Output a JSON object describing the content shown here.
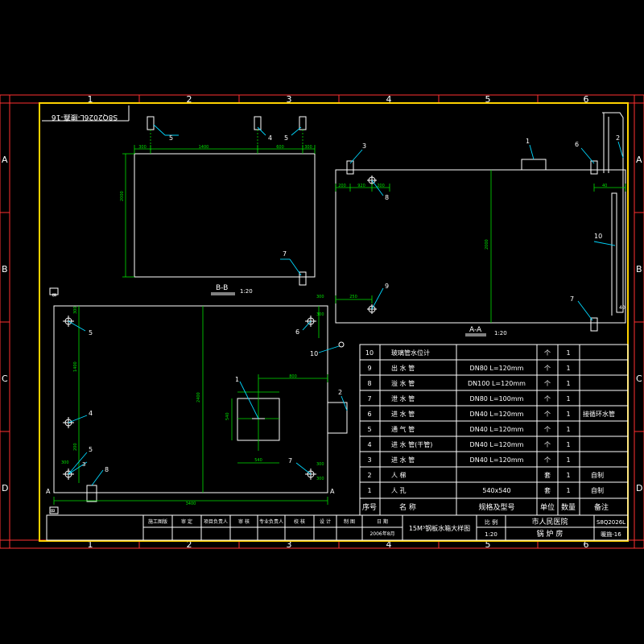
{
  "colors": {
    "background": "#000000",
    "frame": "#ffd200",
    "line": "#ffffff",
    "dimension": "#00e000",
    "leader": "#00d8ff",
    "grid": "#ff3030"
  },
  "border": {
    "cols_top": [
      "1",
      "2",
      "3",
      "4",
      "5",
      "6"
    ],
    "cols_bottom": [
      "1",
      "2",
      "3",
      "4",
      "5",
      "6"
    ],
    "rows_left": [
      "A",
      "B",
      "C",
      "D"
    ],
    "rows_right": [
      "A",
      "B",
      "C",
      "D"
    ]
  },
  "corner_label": "S8Q2026L-腰鑫-16",
  "views": {
    "bb": {
      "title": "B-B",
      "scale": "1:20",
      "dims_top": [
        "300",
        "1400",
        "600",
        "300"
      ],
      "dim_left": "2000",
      "callouts": [
        "5",
        "4",
        "5",
        "7"
      ]
    },
    "aa": {
      "title": "A-A",
      "scale": "1:20",
      "dims_top": [
        "200",
        "920",
        "200"
      ],
      "dim_center": "2000",
      "dim_bottom_left": "250",
      "dims_right": [
        "40",
        "40"
      ],
      "callouts": [
        "3",
        "1",
        "6",
        "2",
        "8",
        "10",
        "9",
        "7"
      ]
    },
    "plan": {
      "sec_top": "B",
      "sec_bottom": "B",
      "sec_a_left": "A",
      "sec_a_right": "A",
      "dim_overall_width": "3400",
      "dim_overall_height": "2400",
      "dim_top_right": "800",
      "dims_left": [
        "300",
        "1400",
        "200",
        "300"
      ],
      "dims_right": [
        "300",
        "300",
        "300",
        "300"
      ],
      "dim_box_w": "540",
      "dim_box_h": "540",
      "callouts": [
        "5",
        "6",
        "10",
        "1",
        "2",
        "4",
        "5",
        "3",
        "8",
        "7"
      ]
    }
  },
  "parts_table": {
    "rows": [
      {
        "no": "10",
        "name": "玻璃管水位计",
        "spec": "",
        "unit": "个",
        "qty": "1",
        "note": ""
      },
      {
        "no": "9",
        "name": "出 水 管",
        "spec": "DN80  L=120mm",
        "unit": "个",
        "qty": "1",
        "note": ""
      },
      {
        "no": "8",
        "name": "溢 水 管",
        "spec": "DN100  L=120mm",
        "unit": "个",
        "qty": "1",
        "note": ""
      },
      {
        "no": "7",
        "name": "泄 水 管",
        "spec": "DN80  L=100mm",
        "unit": "个",
        "qty": "1",
        "note": ""
      },
      {
        "no": "6",
        "name": "进 水 管",
        "spec": "DN40  L=120mm",
        "unit": "个",
        "qty": "1",
        "note": "接循环水管"
      },
      {
        "no": "5",
        "name": "通 气 管",
        "spec": "DN40  L=120mm",
        "unit": "个",
        "qty": "1",
        "note": ""
      },
      {
        "no": "4",
        "name": "进 水 管(干管)",
        "spec": "DN40  L=120mm",
        "unit": "个",
        "qty": "1",
        "note": ""
      },
      {
        "no": "3",
        "name": "进 水 管",
        "spec": "DN40  L=120mm",
        "unit": "个",
        "qty": "1",
        "note": ""
      },
      {
        "no": "2",
        "name": "人  梯",
        "spec": "",
        "unit": "套",
        "qty": "1",
        "note": "自制"
      },
      {
        "no": "1",
        "name": "人  孔",
        "spec": "540x540",
        "unit": "套",
        "qty": "1",
        "note": "自制"
      }
    ],
    "header": {
      "no": "序号",
      "name": "名  称",
      "spec": "规格及型号",
      "unit": "单位",
      "qty": "数量",
      "note": "备注"
    }
  },
  "title_block": {
    "roles": [
      "施工图版",
      "审 定",
      "项目负责人",
      "审 核",
      "专业负责人",
      "校 核",
      "设 计",
      "制 图",
      "日 期"
    ],
    "date": "2006年8月",
    "drawing_title": "15M³钢板水箱大样图",
    "scale_label": "比 例",
    "scale_value": "1:20",
    "client": "市人民医院",
    "building": "锅 炉 房",
    "project_no": "S8Q2026L",
    "sheet_no": "暖施-16"
  }
}
